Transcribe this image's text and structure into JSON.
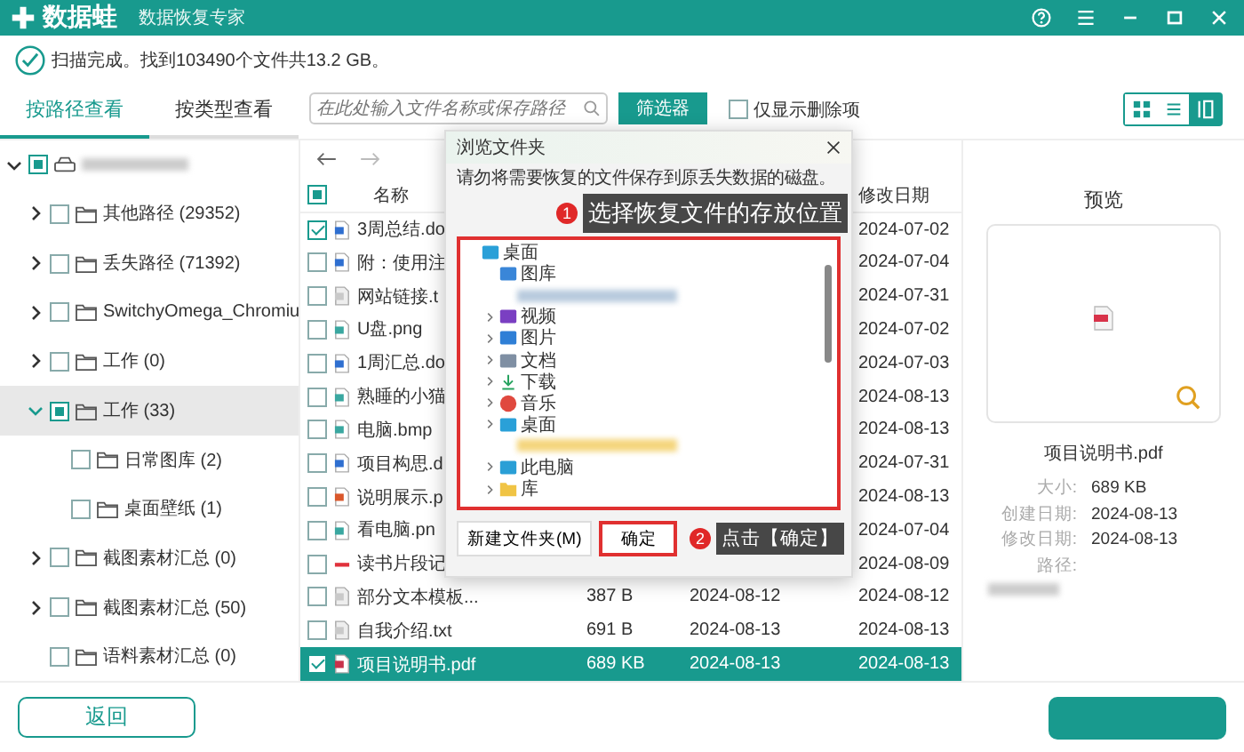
{
  "app": {
    "logo": "数据蛙",
    "subtitle": "数据恢复专家"
  },
  "status": "扫描完成。找到103490个文件共13.2 GB。",
  "view_tabs": [
    {
      "label": "按路径查看",
      "selected": true
    },
    {
      "label": "按类型查看",
      "selected": false
    }
  ],
  "search": {
    "placeholder": "在此处输入文件名称或保存路径"
  },
  "filter_button": "筛选器",
  "deleted_only": {
    "label": "仅显示删除项",
    "checked": false
  },
  "view_modes": [
    {
      "kind": "grid",
      "selected": false
    },
    {
      "kind": "list",
      "selected": false
    },
    {
      "kind": "detail",
      "selected": true
    }
  ],
  "tree": [
    {
      "kind": "drive",
      "blurred": true,
      "expandable": true,
      "expanded": true,
      "checked": true,
      "selected": false,
      "children": [
        {
          "kind": "folder",
          "label": "其他路径 (29352)",
          "expandable": true,
          "expanded": false,
          "checked": false,
          "selected": false
        },
        {
          "kind": "folder",
          "label": "丢失路径 (71392)",
          "expandable": true,
          "expanded": false,
          "checked": false,
          "selected": false
        },
        {
          "kind": "folder",
          "label": "SwitchyOmega_Chromiu",
          "expandable": true,
          "expanded": false,
          "checked": false,
          "selected": false
        },
        {
          "kind": "folder",
          "label": "工作 (0)",
          "expandable": true,
          "expanded": false,
          "checked": false,
          "selected": false
        },
        {
          "kind": "folder",
          "label": "工作 (33)",
          "expandable": true,
          "expanded": true,
          "checked": true,
          "selected": true,
          "children": [
            {
              "kind": "folder",
              "label": "日常图库 (2)",
              "expandable": false,
              "checked": false,
              "selected": false
            },
            {
              "kind": "folder",
              "label": "桌面壁纸 (1)",
              "expandable": false,
              "checked": false,
              "selected": false
            }
          ]
        },
        {
          "kind": "folder",
          "label": "截图素材汇总 (0)",
          "expandable": true,
          "expanded": false,
          "checked": false,
          "selected": false
        },
        {
          "kind": "folder",
          "label": "截图素材汇总 (50)",
          "expandable": true,
          "expanded": false,
          "checked": false,
          "selected": false
        },
        {
          "kind": "folder",
          "label": "语料素材汇总 (0)",
          "expandable": false,
          "checked": false,
          "selected": false
        }
      ]
    }
  ],
  "list": {
    "select_all": {
      "checked": true
    },
    "header": {
      "name": "名称",
      "modified": "修改日期"
    },
    "rows": [
      {
        "name": "3周总结.do",
        "kind": "word",
        "checked": true,
        "selected": false,
        "modified": "2024-07-02"
      },
      {
        "name": "附：使用注",
        "kind": "word",
        "checked": false,
        "selected": false,
        "modified": "2024-07-04"
      },
      {
        "name": "网站链接.t",
        "kind": "text",
        "checked": false,
        "selected": false,
        "modified": "2024-07-31"
      },
      {
        "name": "U盘.png",
        "kind": "image",
        "checked": false,
        "selected": false,
        "modified": "2024-07-02"
      },
      {
        "name": "1周汇总.do",
        "kind": "word",
        "checked": false,
        "selected": false,
        "modified": "2024-07-03"
      },
      {
        "name": "熟睡的小猫",
        "kind": "image",
        "checked": false,
        "selected": false,
        "modified": "2024-08-13"
      },
      {
        "name": "电脑.bmp",
        "kind": "image",
        "checked": false,
        "selected": false,
        "modified": "2024-08-13"
      },
      {
        "name": "项目构思.d",
        "kind": "word",
        "checked": false,
        "selected": false,
        "modified": "2024-07-31"
      },
      {
        "name": "说明展示.p",
        "kind": "ppt",
        "checked": false,
        "selected": false,
        "modified": "2024-08-13"
      },
      {
        "name": "看电脑.pn",
        "kind": "image",
        "checked": false,
        "selected": false,
        "modified": "2024-07-04"
      },
      {
        "name": "读书片段记",
        "kind": "mark",
        "checked": false,
        "selected": false,
        "modified": "2024-08-09"
      },
      {
        "name": "部分文本模板...",
        "kind": "text",
        "checked": false,
        "selected": false,
        "size": "387  B",
        "created": "2024-08-12",
        "modified": "2024-08-12"
      },
      {
        "name": "自我介绍.txt",
        "kind": "text",
        "checked": false,
        "selected": false,
        "size": "691  B",
        "created": "2024-08-13",
        "modified": "2024-08-13"
      },
      {
        "name": "项目说明书.pdf",
        "kind": "pdf",
        "checked": true,
        "selected": true,
        "size": "689 KB",
        "created": "2024-08-13",
        "modified": "2024-08-13"
      }
    ]
  },
  "preview": {
    "title": "预览",
    "file_name": "项目说明书.pdf",
    "props": [
      {
        "label": "大小:",
        "value": "689 KB"
      },
      {
        "label": "创建日期:",
        "value": "2024-08-13"
      },
      {
        "label": "修改日期:",
        "value": "2024-08-13"
      },
      {
        "label": "路径:",
        "blurred": true
      }
    ]
  },
  "footer": {
    "back": "返回"
  },
  "dialog": {
    "title": "浏览文件夹",
    "message": "请勿将需要恢复的文件保存到原丢失数据的磁盘。",
    "tree": [
      {
        "kind": "desktop",
        "label": "桌面",
        "expandable": false,
        "children": [
          {
            "kind": "gallery",
            "label": "图库",
            "expandable": false
          },
          {
            "kind": "drive",
            "blurred": true,
            "expandable": false
          },
          {
            "kind": "video",
            "label": "视频",
            "expandable": true
          },
          {
            "kind": "pictures",
            "label": "图片",
            "expandable": true
          },
          {
            "kind": "documents",
            "label": "文档",
            "expandable": true
          },
          {
            "kind": "downloads",
            "label": "下载",
            "expandable": true
          },
          {
            "kind": "music",
            "label": "音乐",
            "expandable": true
          },
          {
            "kind": "desktop",
            "label": "桌面",
            "expandable": true
          },
          {
            "kind": "folder",
            "blurred": true,
            "expandable": false
          },
          {
            "kind": "pc",
            "label": "此电脑",
            "expandable": true
          },
          {
            "kind": "folder",
            "label": "库",
            "expandable": true
          }
        ]
      }
    ],
    "buttons": [
      {
        "label": "新建文件夹(M)",
        "highlighted": false
      },
      {
        "label": "确定",
        "highlighted": true
      }
    ],
    "callouts": [
      {
        "number": "1",
        "text": "选择恢复文件的存放位置"
      },
      {
        "number": "2",
        "text": "点击【确定】"
      }
    ]
  }
}
